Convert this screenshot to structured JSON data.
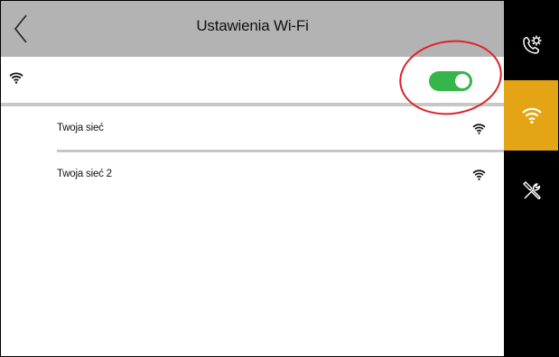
{
  "header": {
    "title": "Ustawienia Wi-Fi"
  },
  "wifi_toggle": {
    "enabled": true,
    "color": "#35b54a"
  },
  "networks": [
    {
      "name": "Twoja sieć",
      "signal_icon": "wifi-signal-icon"
    },
    {
      "name": "Twoja sieć 2",
      "signal_icon": "wifi-signal-icon"
    }
  ],
  "sidebar": {
    "items": [
      {
        "icon": "phone-settings-icon",
        "active": false
      },
      {
        "icon": "wifi-icon",
        "active": true
      },
      {
        "icon": "tools-icon",
        "active": false
      }
    ],
    "active_color": "#e3a514"
  },
  "annotation": {
    "color": "#e0202a"
  }
}
